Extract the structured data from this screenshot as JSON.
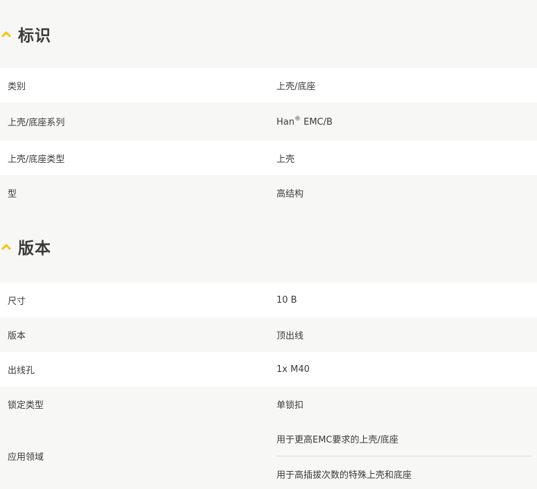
{
  "sections": [
    {
      "title": "标识",
      "rows": [
        {
          "key": "类别",
          "value": "上壳/底座"
        },
        {
          "key": "上壳/底座系列",
          "value_main": "Han",
          "value_sup": "®",
          "value_rest": " EMC/B"
        },
        {
          "key": "上壳/底座类型",
          "value": "上壳"
        },
        {
          "key": "型",
          "value": "高结构"
        }
      ]
    },
    {
      "title": "版本",
      "rows": [
        {
          "key": "尺寸",
          "value": "10 B"
        },
        {
          "key": "版本",
          "value": "顶出线"
        },
        {
          "key": "出线孔",
          "value": "1x M40"
        },
        {
          "key": "锁定类型",
          "value": "单锁扣"
        },
        {
          "key": "应用领域",
          "values": [
            "用于更高EMC要求的上壳/底座",
            "用于高插拔次数的特殊上壳和底座"
          ]
        }
      ]
    }
  ],
  "colors": {
    "accent": "#f5c400",
    "background": "#f7f7f5",
    "row_white": "#ffffff",
    "text": "#3a3a3a"
  }
}
